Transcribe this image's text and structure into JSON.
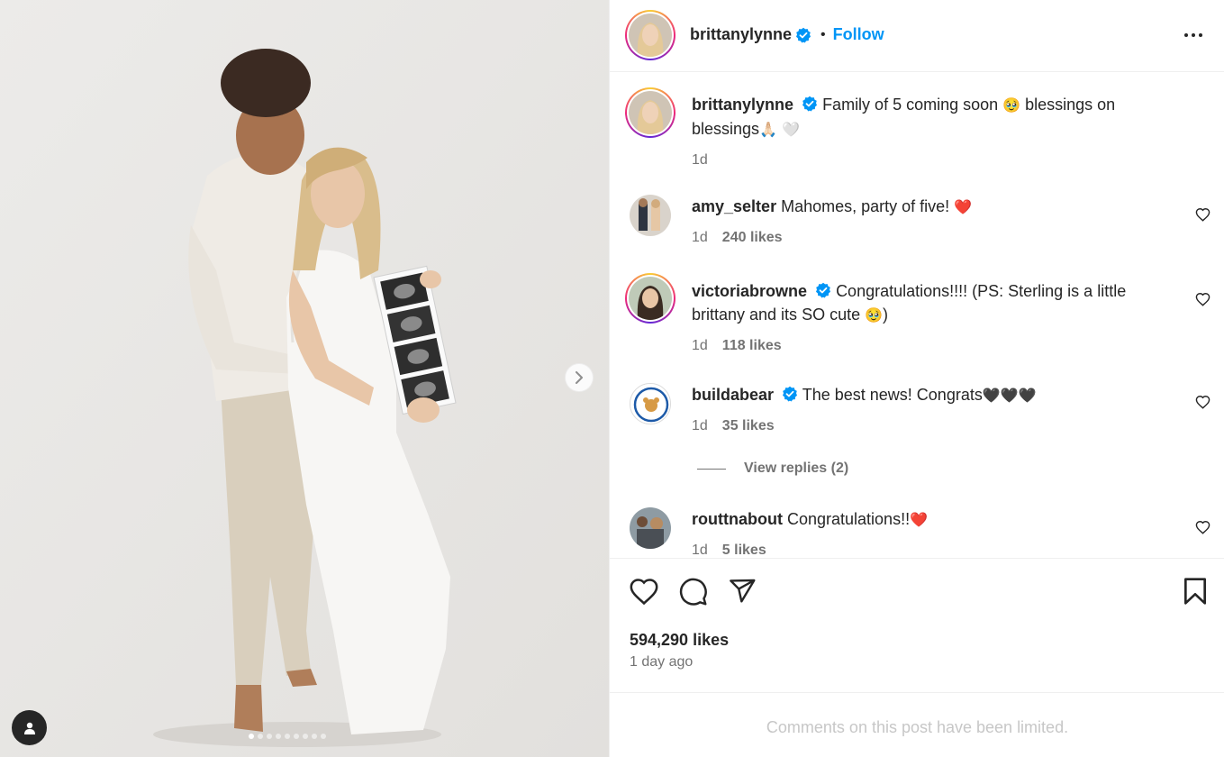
{
  "post": {
    "author": "brittanylynne",
    "follow_label": "Follow",
    "separator": "•",
    "caption_text": "Family of 5 coming soon",
    "caption_emoji_1": "🥹",
    "caption_text_2": "blessings on blessings",
    "caption_emoji_2": "🙏🏻",
    "caption_emoji_3": "🤍",
    "caption_time": "1d",
    "likes": "594,290 likes",
    "time_ago": "1 day ago",
    "comments_limited": "Comments on this post have been limited."
  },
  "comments": [
    {
      "username": "amy_selter",
      "text": "Mahomes, party of five!",
      "emoji": "❤️",
      "time": "1d",
      "likes": "240 likes",
      "verified": false
    },
    {
      "username": "victoriabrowne",
      "text": "Congratulations!!!! (PS: Sterling is a little brittany and its SO cute",
      "emoji": "🥹",
      "text_end": ")",
      "time": "1d",
      "likes": "118 likes",
      "verified": true
    },
    {
      "username": "buildabear",
      "text": "The best news! Congrats",
      "emoji": "🖤🖤🖤",
      "time": "1d",
      "likes": "35 likes",
      "verified": true,
      "view_replies": "View replies (2)"
    },
    {
      "username": "routtnabout",
      "text": "Congratulations!!",
      "emoji": "❤️",
      "time": "1d",
      "likes": "5 likes",
      "verified": false
    }
  ],
  "carousel": {
    "total_slides": 9,
    "active_index": 0
  },
  "colors": {
    "link": "#0095f6",
    "verified": "#0095f6",
    "secondary_text": "#737373",
    "primary_text": "#262626"
  },
  "icons": [
    "verified-badge-icon",
    "more-options-icon",
    "heart-icon",
    "comment-icon",
    "share-icon",
    "bookmark-icon",
    "chevron-right-icon",
    "user-tag-icon"
  ]
}
